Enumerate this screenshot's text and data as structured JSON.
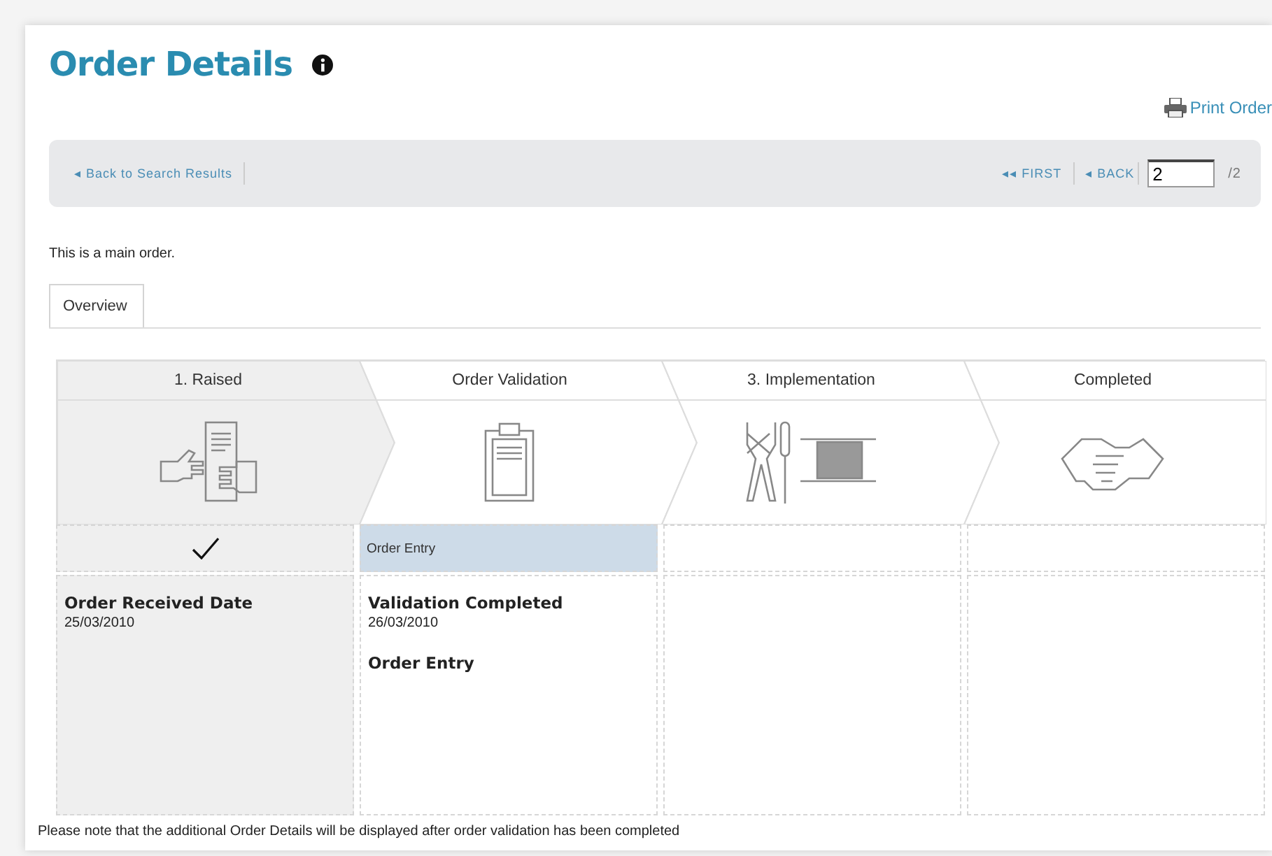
{
  "header": {
    "title": "Order Details",
    "print_link": "Print Order"
  },
  "nav": {
    "back_link": "◂ Back to Search Results",
    "first": "◂◂ FIRST",
    "back": "◂ BACK",
    "page": "2",
    "total": "/2"
  },
  "intro": "This is a main order.",
  "tabs": [
    {
      "label": "Overview",
      "selected": true
    }
  ],
  "stages": [
    {
      "label": "1. Raised",
      "kind": "raise",
      "completed": true,
      "active": false,
      "details": [
        {
          "title": "Order Received Date",
          "date": "25/03/2010"
        }
      ]
    },
    {
      "label": "Order Validation",
      "kind": "validate",
      "completed": false,
      "active": true,
      "status": "Order Entry",
      "details": [
        {
          "title": "Validation Completed",
          "date": "26/03/2010"
        },
        {
          "title": "Order Entry"
        }
      ]
    },
    {
      "label": "3. Implementation",
      "kind": "implement",
      "completed": false,
      "active": false
    },
    {
      "label": "Completed",
      "kind": "complete",
      "completed": false,
      "active": false
    }
  ],
  "note": "Please note that the additional Order Details will be displayed after order validation has been completed"
}
